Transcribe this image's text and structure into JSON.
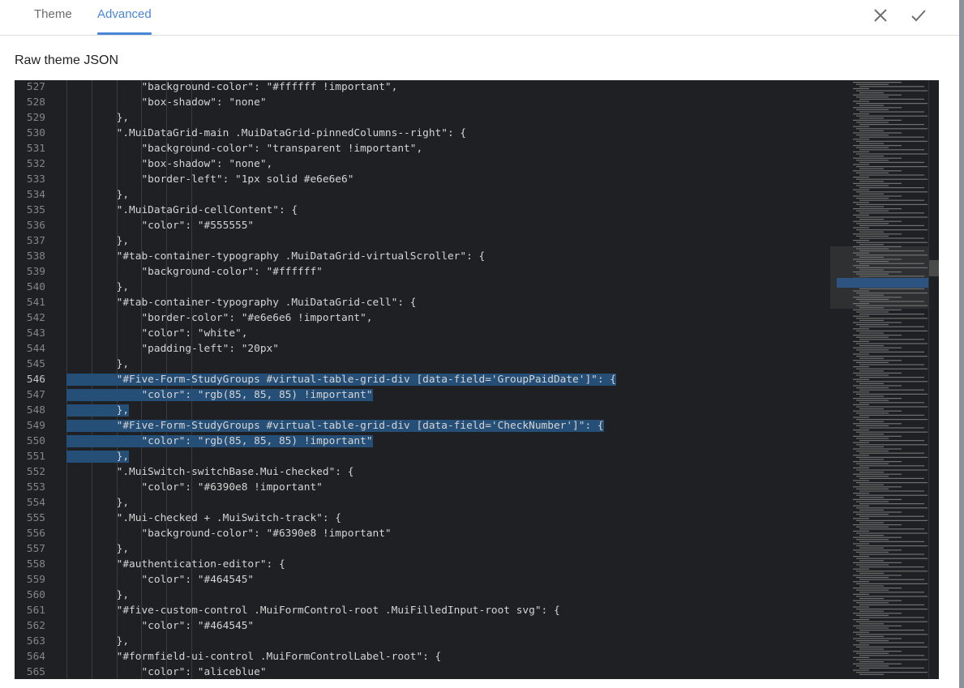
{
  "tabs": [
    {
      "label": "Theme",
      "active": false
    },
    {
      "label": "Advanced",
      "active": true
    }
  ],
  "actions": {
    "close_icon": "close-icon",
    "confirm_icon": "check-icon"
  },
  "section_title": "Raw theme JSON",
  "editor": {
    "selected_lines": [
      546,
      547,
      548,
      549,
      550,
      551
    ],
    "current_line": 546,
    "lines": [
      {
        "n": "527",
        "text": "            \"background-color\": \"#ffffff !important\","
      },
      {
        "n": "528",
        "text": "            \"box-shadow\": \"none\""
      },
      {
        "n": "529",
        "text": "        },"
      },
      {
        "n": "530",
        "text": "        \".MuiDataGrid-main .MuiDataGrid-pinnedColumns--right\": {"
      },
      {
        "n": "531",
        "text": "            \"background-color\": \"transparent !important\","
      },
      {
        "n": "532",
        "text": "            \"box-shadow\": \"none\","
      },
      {
        "n": "533",
        "text": "            \"border-left\": \"1px solid #e6e6e6\""
      },
      {
        "n": "534",
        "text": "        },"
      },
      {
        "n": "535",
        "text": "        \".MuiDataGrid-cellContent\": {"
      },
      {
        "n": "536",
        "text": "            \"color\": \"#555555\""
      },
      {
        "n": "537",
        "text": "        },"
      },
      {
        "n": "538",
        "text": "        \"#tab-container-typography .MuiDataGrid-virtualScroller\": {"
      },
      {
        "n": "539",
        "text": "            \"background-color\": \"#ffffff\""
      },
      {
        "n": "540",
        "text": "        },"
      },
      {
        "n": "541",
        "text": "        \"#tab-container-typography .MuiDataGrid-cell\": {"
      },
      {
        "n": "542",
        "text": "            \"border-color\": \"#e6e6e6 !important\","
      },
      {
        "n": "543",
        "text": "            \"color\": \"white\","
      },
      {
        "n": "544",
        "text": "            \"padding-left\": \"20px\""
      },
      {
        "n": "545",
        "text": "        },"
      },
      {
        "n": "546",
        "text": "        \"#Five-Form-StudyGroups #virtual-table-grid-div [data-field='GroupPaidDate']\": {"
      },
      {
        "n": "547",
        "text": "            \"color\": \"rgb(85, 85, 85) !important\""
      },
      {
        "n": "548",
        "text": "        },"
      },
      {
        "n": "549",
        "text": "        \"#Five-Form-StudyGroups #virtual-table-grid-div [data-field='CheckNumber']\": {"
      },
      {
        "n": "550",
        "text": "            \"color\": \"rgb(85, 85, 85) !important\""
      },
      {
        "n": "551",
        "text": "        },"
      },
      {
        "n": "552",
        "text": "        \".MuiSwitch-switchBase.Mui-checked\": {"
      },
      {
        "n": "553",
        "text": "            \"color\": \"#6390e8 !important\""
      },
      {
        "n": "554",
        "text": "        },"
      },
      {
        "n": "555",
        "text": "        \".Mui-checked + .MuiSwitch-track\": {"
      },
      {
        "n": "556",
        "text": "            \"background-color\": \"#6390e8 !important\""
      },
      {
        "n": "557",
        "text": "        },"
      },
      {
        "n": "558",
        "text": "        \"#authentication-editor\": {"
      },
      {
        "n": "559",
        "text": "            \"color\": \"#464545\""
      },
      {
        "n": "560",
        "text": "        },"
      },
      {
        "n": "561",
        "text": "        \"#five-custom-control .MuiFormControl-root .MuiFilledInput-root svg\": {"
      },
      {
        "n": "562",
        "text": "            \"color\": \"#464545\""
      },
      {
        "n": "563",
        "text": "        },"
      },
      {
        "n": "564",
        "text": "        \"#formfield-ui-control .MuiFormControlLabel-root\": {"
      },
      {
        "n": "565",
        "text": "            \"color\": \"aliceblue\""
      }
    ]
  },
  "colors": {
    "accent": "#4a86d8",
    "editor_bg": "#1f2023",
    "selection": "#264f78"
  }
}
